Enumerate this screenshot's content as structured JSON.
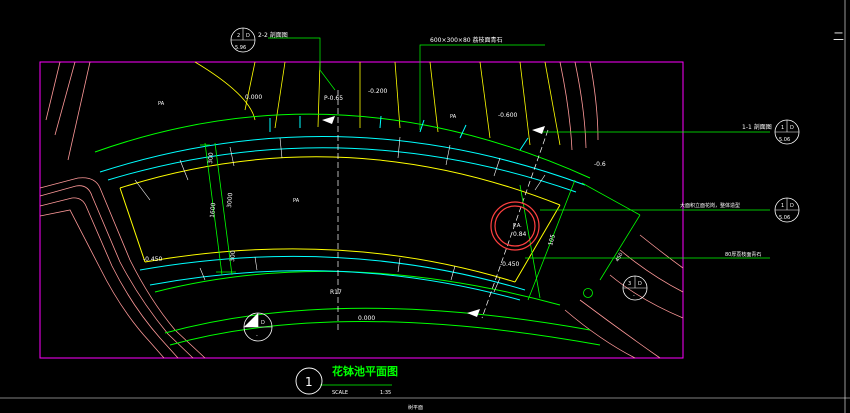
{
  "drawing": {
    "title": "花钵池平面图",
    "drawing_number": "1",
    "scale_label": "SCALE",
    "scale_value": "1:35",
    "footer_text": "树平面",
    "right_edge_mark": "二"
  },
  "callouts": {
    "section_2": {
      "top": "2",
      "mid": "D",
      "bottom": "5.96",
      "label": "2-2 剖面图"
    },
    "section_1": {
      "top": "1",
      "mid": "D",
      "bottom": "5.06",
      "label": "1-1 剖面图"
    },
    "detail_1": {
      "top": "1",
      "mid": "D",
      "bottom": "5.06",
      "label": "大面积立面花岗，整体造型"
    },
    "stone_label": "600×300×80 荔枝面青石",
    "curb_label": "80厚荔枝面青石",
    "detail_3": {
      "top": "3",
      "mid": "D",
      "bottom": "-"
    },
    "detail_bottom": {
      "top": "2",
      "mid": "D",
      "bottom": "-"
    }
  },
  "elevations": {
    "e1": "0.000",
    "e2": "P-0.65",
    "e3": "-0.200",
    "e4": "-0.600",
    "e5": "-0.6",
    "e6": "-0.450",
    "e7": "-0.450",
    "e8": "0.000",
    "pool": "P.A.",
    "pool_center": "PA",
    "pa_left": "PA",
    "pa_right": "PA",
    "circle_label": "0.84"
  },
  "dimensions": {
    "d300_top": "300",
    "d1600": "1600",
    "d3000": "3000",
    "d300_bottom": "300",
    "r_arc": "R17",
    "d_right": "105",
    "d_diag": "450"
  },
  "colors": {
    "frame": "#ff00ff",
    "curb_outer": "#00ff00",
    "curb_cyan": "#00ffff",
    "curb_yellow": "#ffff00",
    "edge_red": "#ff8080",
    "path_pink": "#ff9999",
    "leader": "#00ff00",
    "hatch": "#ffffff"
  }
}
